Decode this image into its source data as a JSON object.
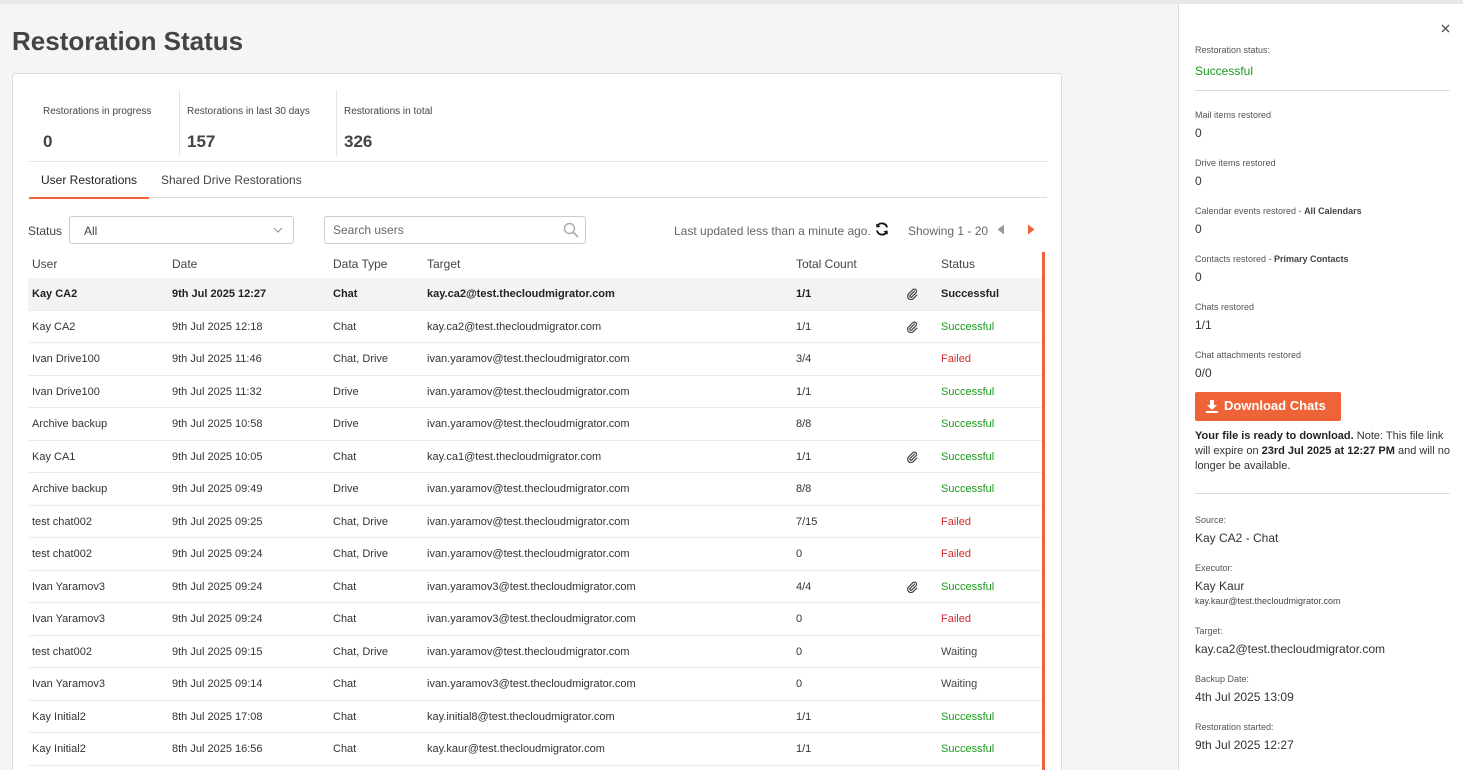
{
  "page": {
    "title": "Restoration Status"
  },
  "stats": [
    {
      "label": "Restorations in progress",
      "value": "0"
    },
    {
      "label": "Restorations in last 30 days",
      "value": "157"
    },
    {
      "label": "Restorations in total",
      "value": "326"
    }
  ],
  "tabs": [
    {
      "label": "User Restorations",
      "active": true
    },
    {
      "label": "Shared Drive Restorations",
      "active": false
    }
  ],
  "filters": {
    "status_label": "Status",
    "status_value": "All",
    "search_placeholder": "Search users",
    "last_updated": "Last updated less than a minute ago.",
    "showing": "Showing 1 - 20"
  },
  "table": {
    "columns": [
      "User",
      "Date",
      "Data Type",
      "Target",
      "Total Count",
      "Status"
    ],
    "rows": [
      {
        "user": "Kay CA2",
        "date": "9th Jul 2025 12:27",
        "data_type": "Chat",
        "target": "kay.ca2@test.thecloudmigrator.com",
        "total_count": "1/1",
        "attachment": true,
        "status": "Successful",
        "selected": true
      },
      {
        "user": "Kay CA2",
        "date": "9th Jul 2025 12:18",
        "data_type": "Chat",
        "target": "kay.ca2@test.thecloudmigrator.com",
        "total_count": "1/1",
        "attachment": true,
        "status": "Successful"
      },
      {
        "user": "Ivan Drive100",
        "date": "9th Jul 2025 11:46",
        "data_type": "Chat, Drive",
        "target": "ivan.yaramov@test.thecloudmigrator.com",
        "total_count": "3/4",
        "attachment": false,
        "status": "Failed"
      },
      {
        "user": "Ivan Drive100",
        "date": "9th Jul 2025 11:32",
        "data_type": "Drive",
        "target": "ivan.yaramov@test.thecloudmigrator.com",
        "total_count": "1/1",
        "attachment": false,
        "status": "Successful"
      },
      {
        "user": "Archive backup",
        "date": "9th Jul 2025 10:58",
        "data_type": "Drive",
        "target": "ivan.yaramov@test.thecloudmigrator.com",
        "total_count": "8/8",
        "attachment": false,
        "status": "Successful"
      },
      {
        "user": "Kay CA1",
        "date": "9th Jul 2025 10:05",
        "data_type": "Chat",
        "target": "kay.ca1@test.thecloudmigrator.com",
        "total_count": "1/1",
        "attachment": true,
        "status": "Successful"
      },
      {
        "user": "Archive backup",
        "date": "9th Jul 2025 09:49",
        "data_type": "Drive",
        "target": "ivan.yaramov@test.thecloudmigrator.com",
        "total_count": "8/8",
        "attachment": false,
        "status": "Successful"
      },
      {
        "user": "test chat002",
        "date": "9th Jul 2025 09:25",
        "data_type": "Chat, Drive",
        "target": "ivan.yaramov@test.thecloudmigrator.com",
        "total_count": "7/15",
        "attachment": false,
        "status": "Failed"
      },
      {
        "user": "test chat002",
        "date": "9th Jul 2025 09:24",
        "data_type": "Chat, Drive",
        "target": "ivan.yaramov@test.thecloudmigrator.com",
        "total_count": "0",
        "attachment": false,
        "status": "Failed"
      },
      {
        "user": "Ivan Yaramov3",
        "date": "9th Jul 2025 09:24",
        "data_type": "Chat",
        "target": "ivan.yaramov3@test.thecloudmigrator.com",
        "total_count": "4/4",
        "attachment": true,
        "status": "Successful"
      },
      {
        "user": "Ivan Yaramov3",
        "date": "9th Jul 2025 09:24",
        "data_type": "Chat",
        "target": "ivan.yaramov3@test.thecloudmigrator.com",
        "total_count": "0",
        "attachment": false,
        "status": "Failed"
      },
      {
        "user": "test chat002",
        "date": "9th Jul 2025 09:15",
        "data_type": "Chat, Drive",
        "target": "ivan.yaramov@test.thecloudmigrator.com",
        "total_count": "0",
        "attachment": false,
        "status": "Waiting"
      },
      {
        "user": "Ivan Yaramov3",
        "date": "9th Jul 2025 09:14",
        "data_type": "Chat",
        "target": "ivan.yaramov3@test.thecloudmigrator.com",
        "total_count": "0",
        "attachment": false,
        "status": "Waiting"
      },
      {
        "user": "Kay Initial2",
        "date": "8th Jul 2025 17:08",
        "data_type": "Chat",
        "target": "kay.initial8@test.thecloudmigrator.com",
        "total_count": "1/1",
        "attachment": false,
        "status": "Successful"
      },
      {
        "user": "Kay Initial2",
        "date": "8th Jul 2025 16:56",
        "data_type": "Chat",
        "target": "kay.kaur@test.thecloudmigrator.com",
        "total_count": "1/1",
        "attachment": false,
        "status": "Successful"
      }
    ]
  },
  "panel": {
    "restoration_status_label": "Restoration status:",
    "restoration_status_value": "Successful",
    "mail_label": "Mail items restored",
    "mail_value": "0",
    "drive_label": "Drive items restored",
    "drive_value": "0",
    "calendar_label": "Calendar events restored - ",
    "calendar_label_bold": "All Calendars",
    "calendar_value": "0",
    "contacts_label": "Contacts restored - ",
    "contacts_label_bold": "Primary Contacts",
    "contacts_value": "0",
    "chats_label": "Chats restored",
    "chats_value": "1/1",
    "chat_attach_label": "Chat attachments restored",
    "chat_attach_value": "0/0",
    "download_label": "Download Chats",
    "ready_bold": "Your file is ready to download.",
    "ready_text1": " Note: This file link will expire on ",
    "ready_expiry": "23rd Jul 2025 at 12:27 PM",
    "ready_text2": " and will no longer be available.",
    "source_label": "Source:",
    "source_value": "Kay CA2 - Chat",
    "executor_label": "Executor:",
    "executor_name": "Kay Kaur",
    "executor_email": "kay.kaur@test.thecloudmigrator.com",
    "target_label": "Target:",
    "target_value": "kay.ca2@test.thecloudmigrator.com",
    "backup_date_label": "Backup Date:",
    "backup_date_value": "4th Jul 2025 13:09",
    "restoration_started_label": "Restoration started:",
    "restoration_started_value": "9th Jul 2025 12:27"
  },
  "colors": {
    "accent": "#ee6438",
    "success": "#1a9a1a",
    "failed": "#d42b2b"
  },
  "icons": [
    "chevron-down-icon",
    "search-icon",
    "refresh-icon",
    "chevron-left-icon",
    "chevron-right-icon",
    "paperclip-icon",
    "close-icon",
    "download-icon"
  ]
}
